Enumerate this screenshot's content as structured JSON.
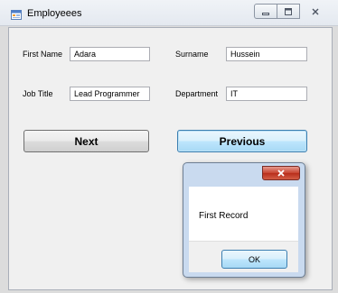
{
  "window": {
    "title": "Employeees",
    "app_icon": "form-icon",
    "controls": {
      "minimize": "minimize-icon",
      "maximize": "maximize-icon",
      "close": "close-icon"
    }
  },
  "form": {
    "first_name_label": "First Name",
    "first_name_value": "Adara",
    "surname_label": "Surname",
    "surname_value": "Hussein",
    "job_title_label": "Job Title",
    "job_title_value": "Lead Programmer",
    "department_label": "Department",
    "department_value": "IT",
    "next_label": "Next",
    "previous_label": "Previous"
  },
  "dialog": {
    "message": "First Record",
    "ok_label": "OK",
    "close_icon": "close-icon"
  },
  "colors": {
    "desktop_background": "#000000",
    "dialog_close": "#c7432f",
    "focus_border": "#3c7fb1"
  }
}
